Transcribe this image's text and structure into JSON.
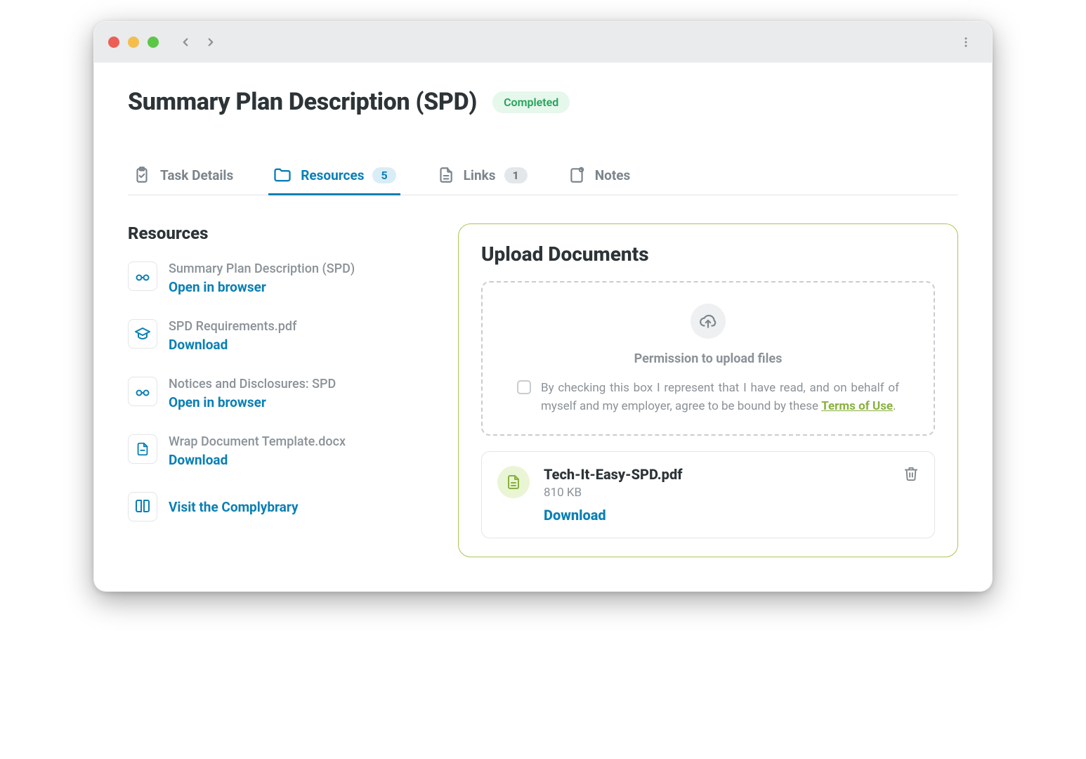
{
  "header": {
    "title": "Summary Plan Description (SPD)",
    "status": "Completed"
  },
  "tabs": [
    {
      "label": "Task Details",
      "count": null
    },
    {
      "label": "Resources",
      "count": "5"
    },
    {
      "label": "Links",
      "count": "1"
    },
    {
      "label": "Notes",
      "count": null
    }
  ],
  "resources": {
    "heading": "Resources",
    "items": [
      {
        "name": "Summary Plan Description (SPD)",
        "action": "Open in browser"
      },
      {
        "name": "SPD Requirements.pdf",
        "action": "Download"
      },
      {
        "name": "Notices and Disclosures: SPD",
        "action": "Open in browser"
      },
      {
        "name": "Wrap Document Template.docx",
        "action": "Download"
      }
    ],
    "visit_link": "Visit the Complybrary"
  },
  "upload": {
    "heading": "Upload Documents",
    "permission_title": "Permission to upload files",
    "permission_text_prefix": "By checking this box I represent that I have read, and on behalf of myself and my employer, agree to be bound by these ",
    "permission_link": "Terms of Use",
    "permission_text_suffix": ".",
    "file": {
      "name": "Tech-It-Easy-SPD.pdf",
      "size": "810 KB",
      "action": "Download"
    }
  }
}
